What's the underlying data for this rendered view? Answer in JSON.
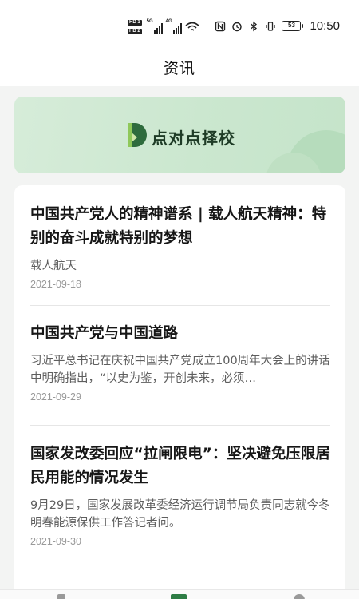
{
  "status_bar": {
    "hd1": "HD 1",
    "hd2": "HD 2",
    "net1": "5G",
    "net2": "4G",
    "battery": "53",
    "time": "10:50"
  },
  "header": {
    "title": "资讯"
  },
  "banner": {
    "text": "点对点择校",
    "accent": "#2e6b3d"
  },
  "news": [
    {
      "title": "中国共产党人的精神谱系 | 载人航天精神：特别的奋斗成就特别的梦想",
      "summary": "载人航天",
      "date": "2021-09-18"
    },
    {
      "title": "中国共产党与中国道路",
      "summary": "习近平总书记在庆祝中国共产党成立100周年大会上的讲话中明确指出，“以史为鉴，开创未来，必须…",
      "date": "2021-09-29"
    },
    {
      "title": "国家发改委回应“拉闸限电”：坚决避免压限居民用能的情况发生",
      "summary": "9月29日，国家发展改革委经济运行调节局负责同志就今冬明春能源保供工作答记者问。",
      "date": "2021-09-30"
    }
  ],
  "bottom_nav": {
    "active_color": "#2e7d45",
    "icons": [
      "home-icon",
      "school-icon",
      "profile-icon"
    ]
  }
}
